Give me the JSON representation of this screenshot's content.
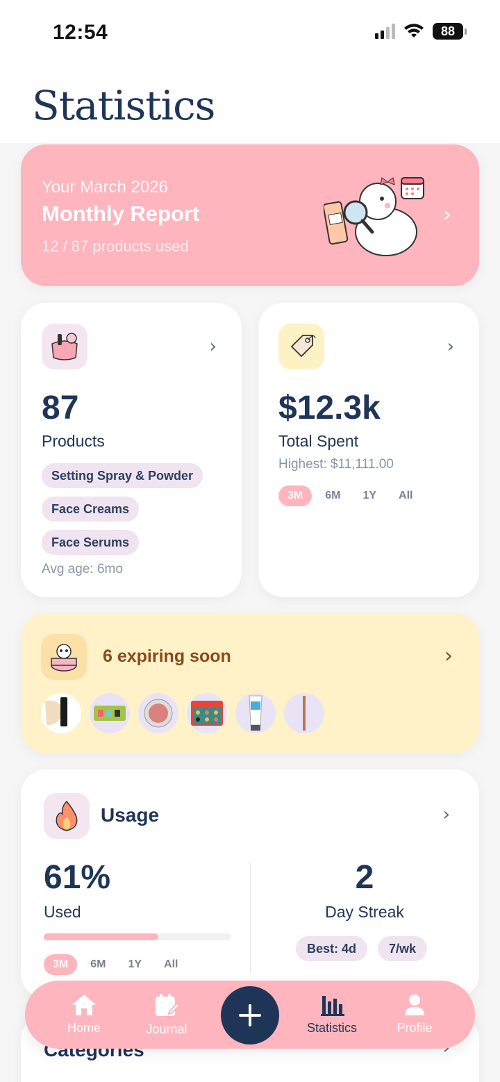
{
  "status_bar": {
    "time": "12:54",
    "battery": "88"
  },
  "page": {
    "title": "Statistics"
  },
  "monthly_report": {
    "line1": "Your March 2026",
    "title": "Monthly Report",
    "subtitle": "12 / 87 products used"
  },
  "products_card": {
    "count": "87",
    "label": "Products",
    "tags": [
      "Setting Spray & Powder",
      "Face Creams",
      "Face Serums"
    ],
    "avg_age": "Avg age: 6mo",
    "icon": "makeup-bag-icon"
  },
  "spent_card": {
    "amount": "$12.3k",
    "label": "Total Spent",
    "highest": "Highest: $11,111.00",
    "ranges": [
      "3M",
      "6M",
      "1Y",
      "All"
    ],
    "selected_range": "3M",
    "icon": "price-tag-icon"
  },
  "expiring_card": {
    "title": "6 expiring soon",
    "icon": "skull-jar-icon",
    "products": [
      "foundation",
      "eyeshadow-palette",
      "blush-compact",
      "color-palette",
      "sunscreen-tube",
      "eyeliner-pencil"
    ]
  },
  "usage_card": {
    "title": "Usage",
    "percent": "61%",
    "percent_label": "Used",
    "used_fraction": 0.61,
    "ranges": [
      "3M",
      "6M",
      "1Y",
      "All"
    ],
    "selected_range": "3M",
    "streak": "2",
    "streak_label": "Day Streak",
    "best": "Best: 4d",
    "rate": "7/wk",
    "icon": "flame-icon"
  },
  "categories_card": {
    "title": "Categories"
  },
  "tab_bar": {
    "items": [
      {
        "label": "Home",
        "icon": "home-icon"
      },
      {
        "label": "Journal",
        "icon": "journal-icon"
      },
      {
        "label": "Statistics",
        "icon": "bar-chart-icon"
      },
      {
        "label": "Profile",
        "icon": "profile-icon"
      }
    ],
    "active": "Statistics"
  },
  "colors": {
    "primary_navy": "#1f3558",
    "accent_pink": "#ffb5be",
    "expiring_bg": "#fff2c8",
    "chip_lilac": "#efe4f0"
  }
}
